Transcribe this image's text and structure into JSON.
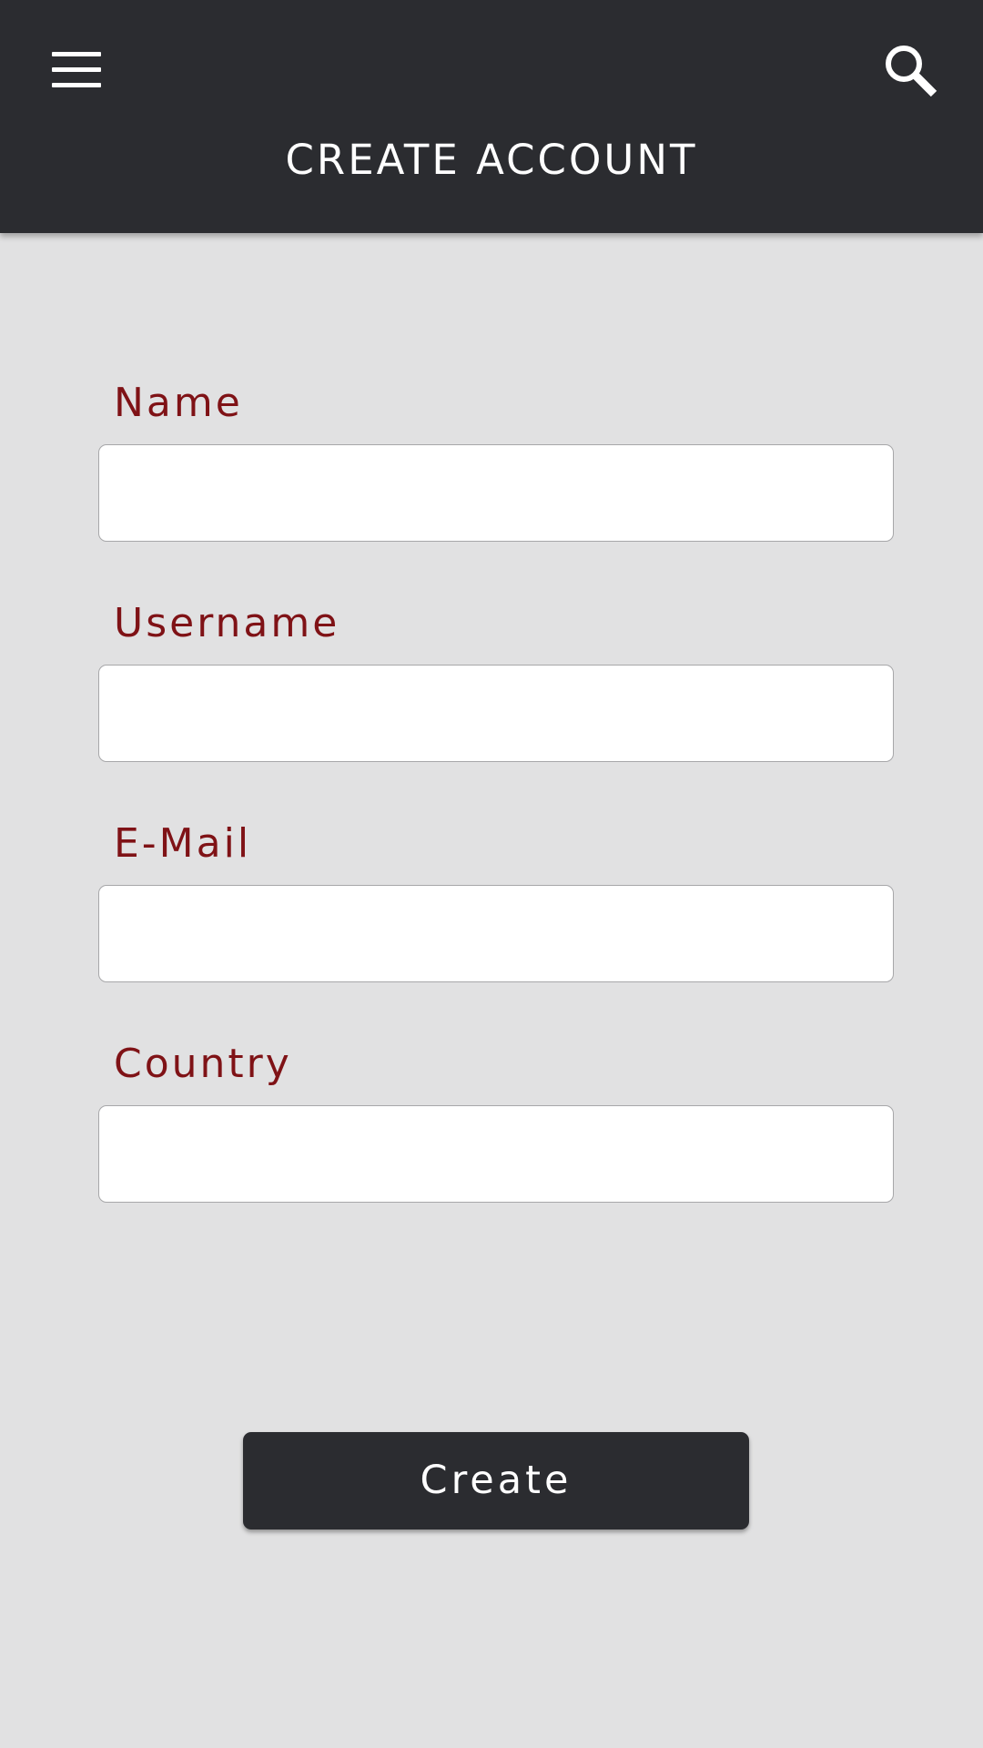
{
  "app_bar": {
    "title": "CREATE ACCOUNT",
    "menu_icon": "hamburger-menu-icon",
    "search_icon": "search-icon",
    "background": "#2b2c30"
  },
  "form": {
    "fields": [
      {
        "label": "Name",
        "value": "",
        "placeholder": ""
      },
      {
        "label": "Username",
        "value": "",
        "placeholder": ""
      },
      {
        "label": "E-Mail",
        "value": "",
        "placeholder": ""
      },
      {
        "label": "Country",
        "value": "",
        "placeholder": ""
      }
    ],
    "label_color": "#7f1216",
    "submit_label": "Create"
  },
  "page_background": "#e1e1e2"
}
